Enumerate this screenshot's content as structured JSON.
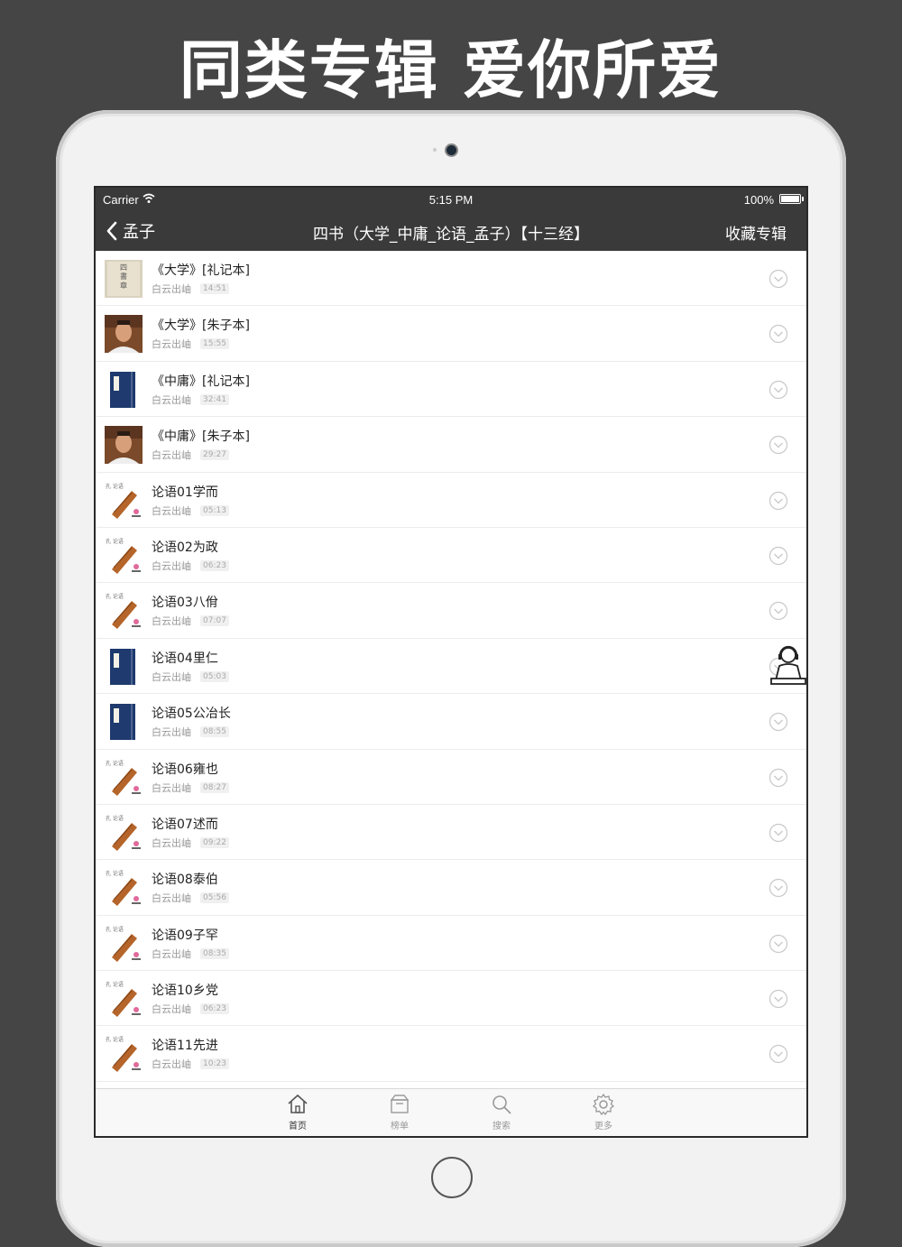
{
  "headline": "同类专辑 爱你所爱",
  "status": {
    "carrier": "Carrier",
    "time": "5:15 PM",
    "battery": "100%"
  },
  "nav": {
    "back_label": "孟子",
    "title": "四书（大学_中庸_论语_孟子）【十三经】",
    "right_label": "收藏专辑"
  },
  "tracks": [
    {
      "title": "《大学》[礼记本]",
      "author": "白云出岫",
      "duration": "14:51",
      "thumb": "book-cover-gray"
    },
    {
      "title": "《大学》[朱子本]",
      "author": "白云出岫",
      "duration": "15:55",
      "thumb": "portrait"
    },
    {
      "title": "《中庸》[礼记本]",
      "author": "白云出岫",
      "duration": "32:41",
      "thumb": "book-cover-blue"
    },
    {
      "title": "《中庸》[朱子本]",
      "author": "白云出岫",
      "duration": "29:27",
      "thumb": "portrait"
    },
    {
      "title": "论语01学而",
      "author": "白云出岫",
      "duration": "05:13",
      "thumb": "bamboo-scroll"
    },
    {
      "title": "论语02为政",
      "author": "白云出岫",
      "duration": "06:23",
      "thumb": "bamboo-scroll"
    },
    {
      "title": "论语03八佾",
      "author": "白云出岫",
      "duration": "07:07",
      "thumb": "bamboo-scroll"
    },
    {
      "title": "论语04里仁",
      "author": "白云出岫",
      "duration": "05:03",
      "thumb": "book-cover-blue"
    },
    {
      "title": "论语05公冶长",
      "author": "白云出岫",
      "duration": "08:55",
      "thumb": "book-cover-blue"
    },
    {
      "title": "论语06雍也",
      "author": "白云出岫",
      "duration": "08:27",
      "thumb": "bamboo-scroll"
    },
    {
      "title": "论语07述而",
      "author": "白云出岫",
      "duration": "09:22",
      "thumb": "bamboo-scroll"
    },
    {
      "title": "论语08泰伯",
      "author": "白云出岫",
      "duration": "05:56",
      "thumb": "bamboo-scroll"
    },
    {
      "title": "论语09子罕",
      "author": "白云出岫",
      "duration": "08:35",
      "thumb": "bamboo-scroll"
    },
    {
      "title": "论语10乡党",
      "author": "白云出岫",
      "duration": "06:23",
      "thumb": "bamboo-scroll"
    },
    {
      "title": "论语11先进",
      "author": "白云出岫",
      "duration": "10:23",
      "thumb": "bamboo-scroll"
    }
  ],
  "tabs": [
    {
      "label": "首页",
      "icon": "home-icon",
      "active": true
    },
    {
      "label": "榜单",
      "icon": "ranking-box-icon",
      "active": false
    },
    {
      "label": "搜索",
      "icon": "search-icon",
      "active": false
    },
    {
      "label": "更多",
      "icon": "gear-icon",
      "active": false
    }
  ],
  "colors": {
    "background": "#454545",
    "bar": "#3a3a3a",
    "text_secondary": "#999999"
  }
}
